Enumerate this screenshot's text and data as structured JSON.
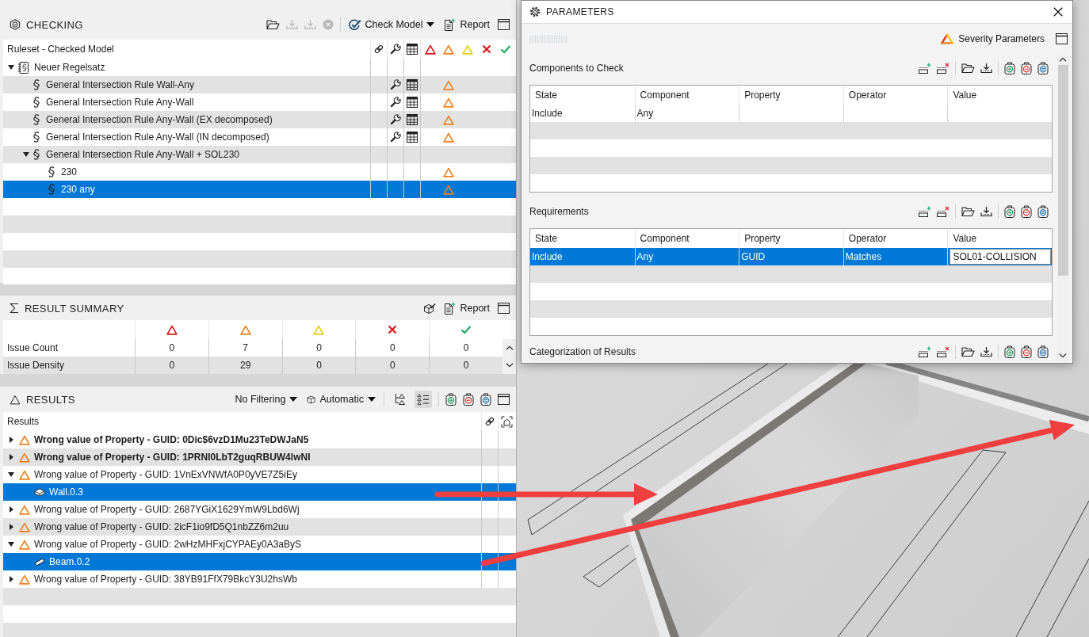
{
  "checking": {
    "title": "CHECKING",
    "check_model": "Check Model",
    "report": "Report",
    "column_1": "Ruleset - Checked Model",
    "tree": [
      {
        "label": "Neuer Regelsatz",
        "kind": "ruleset",
        "expanded": true,
        "has_parameters": false,
        "has_table": false,
        "selected": false,
        "children": [
          {
            "label": "General Intersection Rule Wall-Any",
            "kind": "rule",
            "has_parameters": true,
            "has_table": true,
            "color": "#f0821e",
            "selected": false
          },
          {
            "label": "General Intersection Rule Any-Wall",
            "kind": "rule",
            "has_parameters": true,
            "has_table": true,
            "color": "#f0821e",
            "selected": false
          },
          {
            "label": "General Intersection Rule Any-Wall (EX decomposed)",
            "kind": "rule",
            "has_parameters": true,
            "has_table": true,
            "color": "#f0821e",
            "selected": false
          },
          {
            "label": "General Intersection Rule Any-Wall (IN decomposed)",
            "kind": "rule",
            "has_parameters": true,
            "has_table": true,
            "color": "#f0821e",
            "selected": false
          },
          {
            "label": "General Intersection Rule Any-Wall + SOL230",
            "kind": "rule",
            "expanded": true,
            "has_parameters": false,
            "has_table": false,
            "selected": false,
            "children": [
              {
                "label": "230",
                "kind": "rule",
                "has_parameters": false,
                "has_table": false,
                "color": "#f0821e",
                "selected": false
              },
              {
                "label": "230 any",
                "kind": "rule",
                "has_parameters": false,
                "has_table": false,
                "color": "#f0821e",
                "selected": true
              }
            ]
          }
        ]
      }
    ]
  },
  "summary": {
    "title": "RESULT SUMMARY",
    "report": "Report",
    "rows": [
      {
        "label": "Issue Count",
        "values": [
          "0",
          "7",
          "0",
          "0",
          "0"
        ]
      },
      {
        "label": "Issue Density",
        "values": [
          "0",
          "29",
          "0",
          "0",
          "0"
        ]
      }
    ]
  },
  "results": {
    "title": "RESULTS",
    "filter": "No Filtering",
    "display": "Automatic",
    "view_toggles": [
      {
        "kind": "tree",
        "on": false
      },
      {
        "kind": "list",
        "on": true
      }
    ],
    "column_1": "Results",
    "items": [
      {
        "label": "Wrong value of Property - GUID: 0Dic$6vzD1Mu23TeDWJaN5",
        "color": "#f0821e",
        "bold": true,
        "expanded": false,
        "selected": false
      },
      {
        "label": "Wrong value of Property - GUID: 1PRNI0LbT2guqRBUW4lwNI",
        "color": "#f0821e",
        "bold": true,
        "expanded": false,
        "selected": false
      },
      {
        "label": "Wrong value of Property - GUID: 1VnExVNWfA0P0yVE7Z5iEy",
        "color": "#f0821e",
        "bold": false,
        "expanded": true,
        "selected": false,
        "children": [
          {
            "label": "Wall.0.3",
            "kind": "wall",
            "selected": true
          }
        ]
      },
      {
        "label": "Wrong value of Property - GUID: 2687YGiX1629YmW9Lbd6Wj",
        "color": "#f0821e",
        "bold": false,
        "expanded": false,
        "selected": false
      },
      {
        "label": "Wrong value of Property - GUID: 2icF1io9fD5Q1nbZZ6m2uu",
        "color": "#f0821e",
        "bold": false,
        "expanded": false,
        "selected": false
      },
      {
        "label": "Wrong value of Property - GUID: 2wHzMHFxjCYPAEy0A3aByS",
        "color": "#f0821e",
        "bold": false,
        "expanded": true,
        "selected": false,
        "children": [
          {
            "label": "Beam.0.2",
            "kind": "beam",
            "selected": true
          }
        ]
      },
      {
        "label": "Wrong value of Property - GUID: 38YB91FfX79BkcY3U2hsWb",
        "color": "#f0821e",
        "bold": false,
        "expanded": false,
        "selected": false
      }
    ]
  },
  "parameters": {
    "title": "PARAMETERS",
    "severity_parameters": "Severity Parameters",
    "sections": [
      {
        "title": "Components to Check",
        "columns": [
          "State",
          "Component",
          "Property",
          "Operator",
          "Value"
        ],
        "rows": [
          {
            "state": "Include",
            "component": "Any",
            "selected": false,
            "editing": false
          }
        ]
      },
      {
        "title": "Requirements",
        "columns": [
          "State",
          "Component",
          "Property",
          "Operator",
          "Value"
        ],
        "rows": [
          {
            "state": "Include",
            "component": "Any",
            "property": "GUID",
            "operator": "Matches",
            "value": "SOL01-COLLISION",
            "selected": true,
            "editing": true
          }
        ]
      },
      {
        "title": "Categorization of Results"
      }
    ]
  }
}
